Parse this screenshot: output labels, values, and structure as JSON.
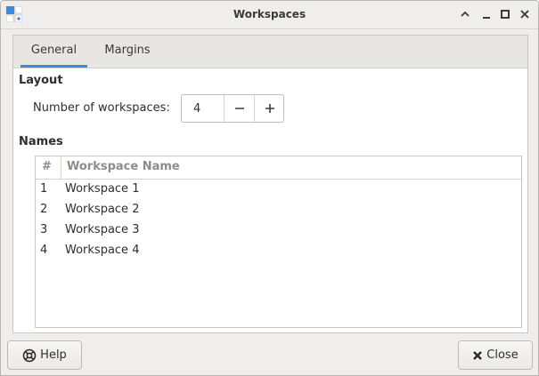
{
  "window": {
    "title": "Workspaces",
    "controls": [
      "minimize-icon",
      "restore-icon",
      "maximize-icon",
      "close-icon"
    ]
  },
  "tabs": [
    {
      "label": "General",
      "active": true
    },
    {
      "label": "Margins",
      "active": false
    }
  ],
  "general": {
    "layout_heading": "Layout",
    "count_label": "Number of workspaces:",
    "count_value": "4",
    "names_heading": "Names",
    "columns": [
      "#",
      "Workspace Name"
    ],
    "rows": [
      {
        "num": "1",
        "name": "Workspace 1"
      },
      {
        "num": "2",
        "name": "Workspace 2"
      },
      {
        "num": "3",
        "name": "Workspace 3"
      },
      {
        "num": "4",
        "name": "Workspace 4"
      }
    ]
  },
  "footer": {
    "help_label": "Help",
    "close_label": "Close",
    "help_icon": "help-icon",
    "close_icon": "close-x-icon"
  },
  "colors": {
    "accent": "#3a8ae0",
    "window_bg": "#efeeed",
    "text": "#2e2e2e",
    "column_header_text": "#8e8c89"
  }
}
